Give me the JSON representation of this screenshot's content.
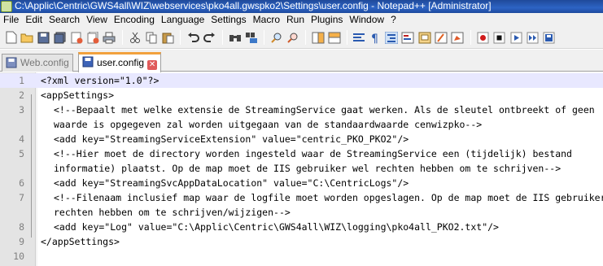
{
  "window": {
    "title": "C:\\Applic\\Centric\\GWS4all\\WIZ\\webservices\\pko4all.gwspko2\\Settings\\user.config - Notepad++ [Administrator]"
  },
  "menu": [
    "File",
    "Edit",
    "Search",
    "View",
    "Encoding",
    "Language",
    "Settings",
    "Macro",
    "Run",
    "Plugins",
    "Window",
    "?"
  ],
  "toolbar": {
    "buttons": [
      "new-file",
      "open-file",
      "save",
      "save-all",
      "close",
      "close-all",
      "print",
      "cut",
      "copy",
      "paste",
      "undo",
      "redo",
      "find",
      "replace",
      "zoom-in",
      "zoom-out",
      "sync-vertical",
      "sync-horizontal",
      "word-wrap",
      "show-all-characters",
      "indent-guide",
      "user-defined-language",
      "doc-map",
      "function-list",
      "record-macro",
      "stop-recording",
      "playback-macro",
      "run-macro-multiple",
      "save-macro"
    ]
  },
  "tabs": [
    {
      "label": "Web.config",
      "active": false
    },
    {
      "label": "user.config",
      "active": true
    }
  ],
  "editor": {
    "current_line": 1,
    "lines": [
      {
        "num": "1",
        "indent": 0,
        "text": "<?xml version=\"1.0\"?>"
      },
      {
        "num": "2",
        "indent": 0,
        "text": "<appSettings>"
      },
      {
        "num": "3",
        "indent": 2,
        "text": "<!--Bepaalt met welke extensie de StreamingService gaat werken. Als de sleutel ontbreekt of geen"
      },
      {
        "num": "",
        "indent": 2,
        "text": "waarde is opgegeven zal worden uitgegaan van de standaardwaarde cenwizpko-->"
      },
      {
        "num": "4",
        "indent": 2,
        "text": "<add key=\"StreamingServiceExtension\" value=\"centric_PKO_PKO2\"/>"
      },
      {
        "num": "5",
        "indent": 2,
        "text": "<!--Hier moet de directory worden ingesteld waar de StreamingService een (tijdelijk) bestand"
      },
      {
        "num": "",
        "indent": 2,
        "text": "informatie) plaatst. Op de map moet de IIS gebruiker wel rechten hebben om te schrijven-->"
      },
      {
        "num": "6",
        "indent": 2,
        "text": "<add key=\"StreamingSvcAppDataLocation\" value=\"C:\\CentricLogs\"/>"
      },
      {
        "num": "7",
        "indent": 2,
        "text": "<!--Filenaam inclusief map waar de logfile moet worden opgeslagen. Op de map moet de IIS gebruiker"
      },
      {
        "num": "",
        "indent": 2,
        "text": "rechten hebben om te schrijven/wijzigen-->"
      },
      {
        "num": "8",
        "indent": 2,
        "text": "<add key=\"Log\" value=\"C:\\Applic\\Centric\\GWS4all\\WIZ\\logging\\pko4all_PKO2.txt\"/>"
      },
      {
        "num": "9",
        "indent": 0,
        "text": "</appSettings>"
      },
      {
        "num": "10",
        "indent": 0,
        "text": ""
      }
    ]
  },
  "colors": {
    "titlebar": "#2d64c4",
    "active_tab_accent": "#f2a13d",
    "current_line": "#e8e8ff",
    "spellcheck": "#dd3333"
  }
}
